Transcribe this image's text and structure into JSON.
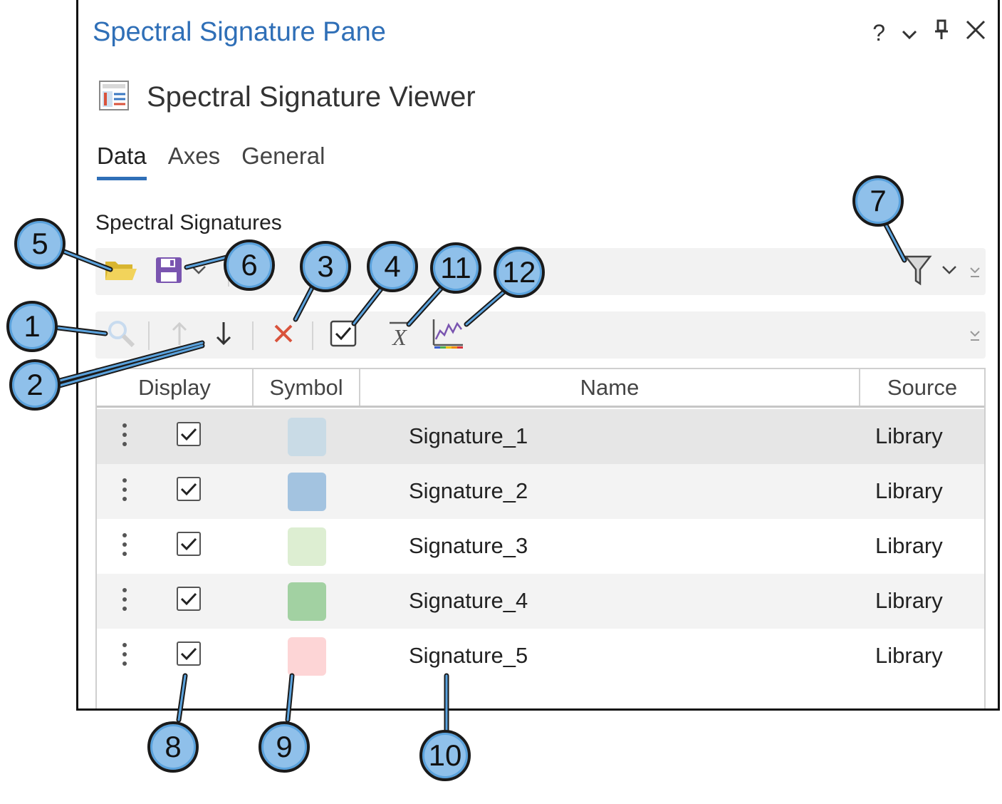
{
  "pane": {
    "title": "Spectral Signature Pane",
    "help": "?",
    "viewer_title": "Spectral Signature Viewer"
  },
  "tabs": [
    {
      "label": "Data",
      "active": true
    },
    {
      "label": "Axes",
      "active": false
    },
    {
      "label": "General",
      "active": false
    }
  ],
  "section_label": "Spectral Signatures",
  "grid": {
    "columns": [
      "Display",
      "Symbol",
      "Name",
      "Source"
    ],
    "rows": [
      {
        "display": true,
        "color": "#c9dbe6",
        "name": "Signature_1",
        "source": "Library"
      },
      {
        "display": true,
        "color": "#a3c3e0",
        "name": "Signature_2",
        "source": "Library"
      },
      {
        "display": true,
        "color": "#ddeed2",
        "name": "Signature_3",
        "source": "Library"
      },
      {
        "display": true,
        "color": "#a2d1a2",
        "name": "Signature_4",
        "source": "Library"
      },
      {
        "display": true,
        "color": "#fdd5d6",
        "name": "Signature_5",
        "source": "Library"
      }
    ]
  },
  "callouts": [
    "1",
    "2",
    "3",
    "4",
    "5",
    "6",
    "7",
    "8",
    "9",
    "10",
    "11",
    "12"
  ],
  "colors": {
    "accent": "#2f6fb7",
    "callout_fill": "#8fc0ea",
    "delete_red": "#d9533c"
  }
}
